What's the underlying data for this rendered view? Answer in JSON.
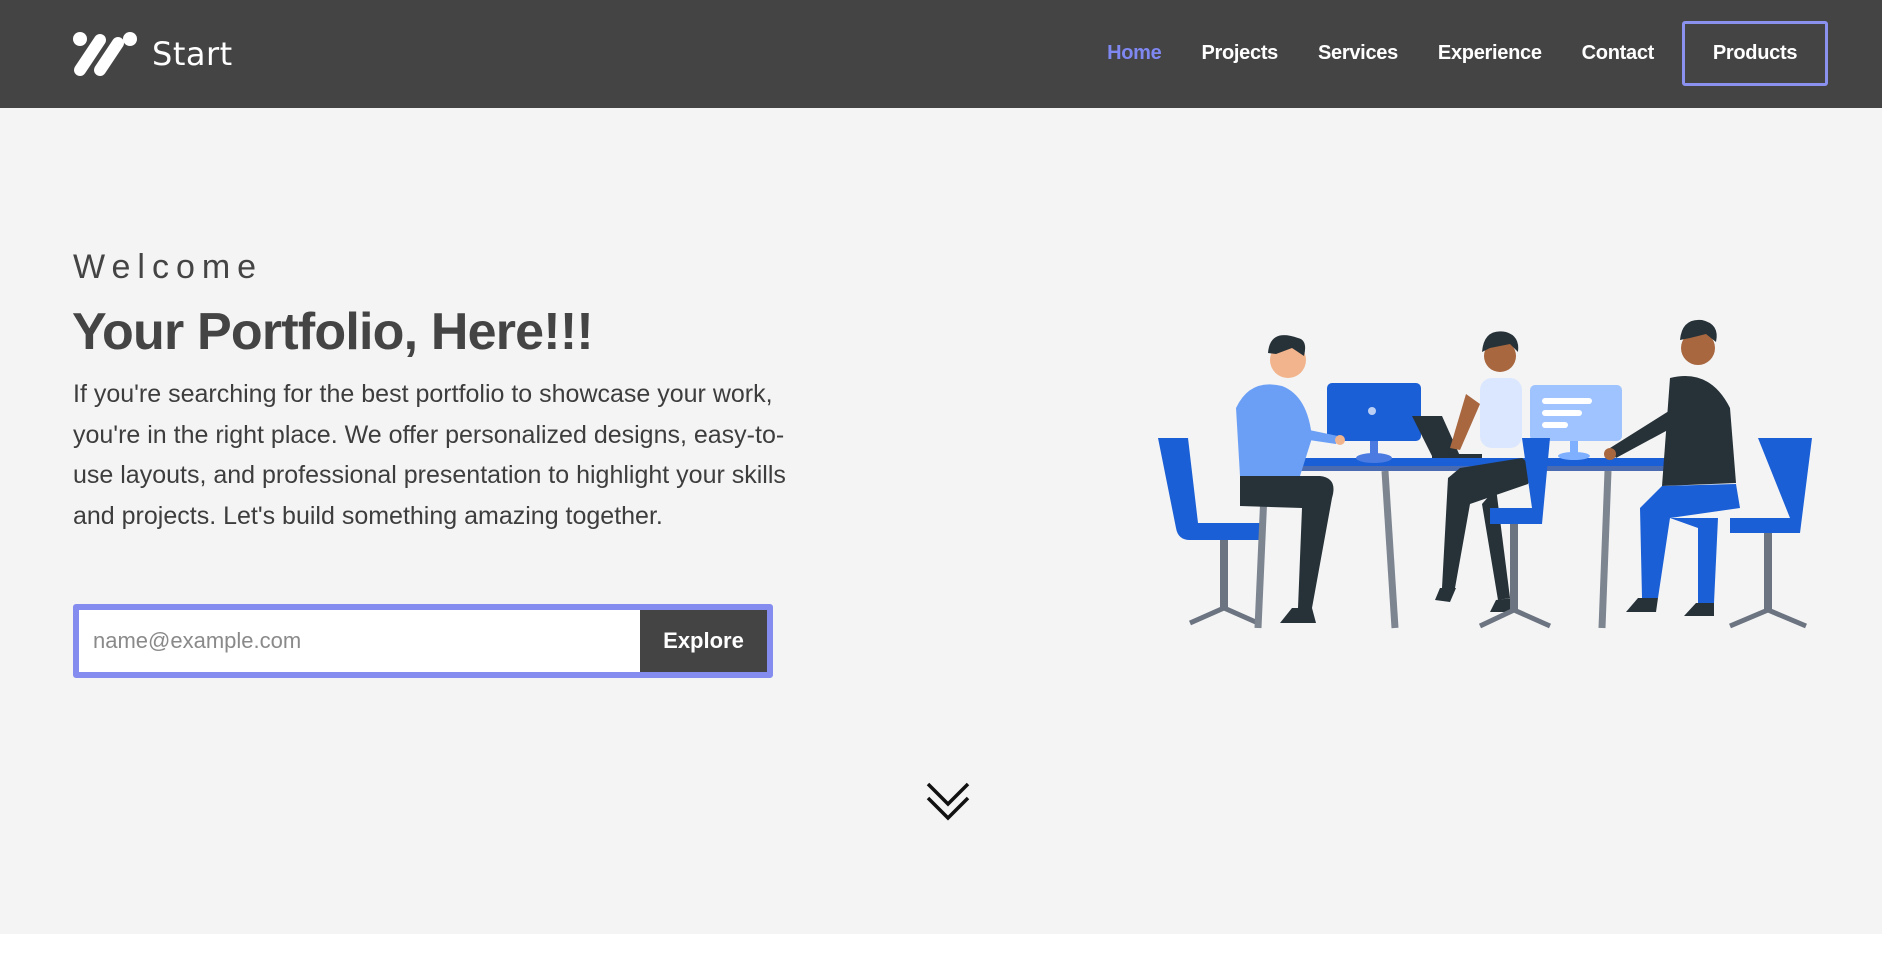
{
  "brand": {
    "name": "Start",
    "logo_icon": "slash-logo-icon"
  },
  "nav": {
    "links": [
      "Home",
      "Projects",
      "Services",
      "Experience",
      "Contact"
    ],
    "active": "Home",
    "cta_label": "Products"
  },
  "hero": {
    "welcome": "Welcome",
    "headline": "Your Portfolio, Here!!!",
    "lead": "If you're searching for the best portfolio to showcase your work, you're in the right place. We offer personalized designs, easy-to-use layouts, and professional presentation to highlight your skills and projects. Let's build something amazing together.",
    "signup": {
      "placeholder": "name@example.com",
      "value": "",
      "button_label": "Explore"
    },
    "scroll_icon": "double-chevron-down-icon",
    "illustration": "team-working-at-table-illustration"
  },
  "colors": {
    "navbar": "#444444",
    "accent": "#7f87f0",
    "hero_bg": "#f4f4f5",
    "illustration_blue": "#1a5fd6"
  }
}
